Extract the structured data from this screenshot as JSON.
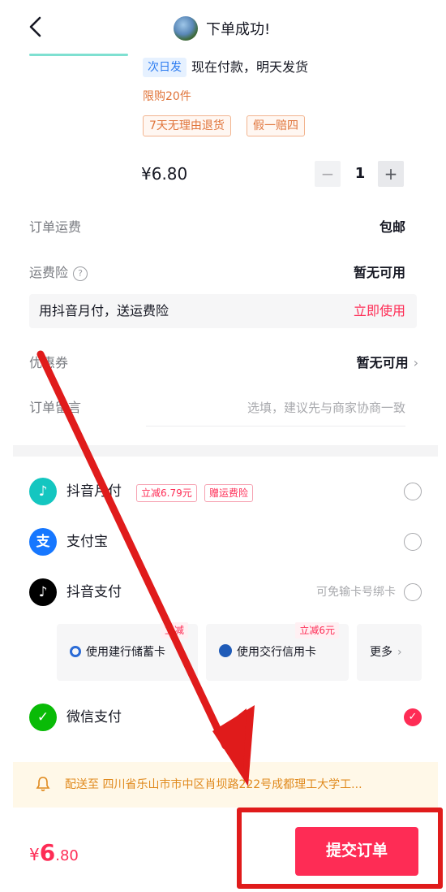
{
  "header": {
    "title": "下单成功!",
    "back_icon": "chevron-left-icon"
  },
  "product": {
    "ship_tag": "次日发",
    "ship_text": "现在付款，明天发货",
    "limit": "限购20件",
    "service_tags": [
      "7天无理由退货",
      "假一赔四"
    ],
    "price": "¥6.80",
    "quantity": "1",
    "minus": "−",
    "plus": "+"
  },
  "order": {
    "shipping_label": "订单运费",
    "shipping_value": "包邮",
    "insurance_label": "运费险",
    "insurance_value": "暂无可用",
    "promo_text": "用抖音月付，送运费险",
    "promo_link": "立即使用",
    "coupon_label": "优惠券",
    "coupon_value": "暂无可用",
    "remark_label": "订单留言",
    "remark_placeholder": "选填，建议先与商家协商一致"
  },
  "payment": {
    "methods": [
      {
        "label": "抖音月付",
        "badges": [
          "立减6.79元",
          "赠运费险"
        ],
        "selected": false
      },
      {
        "label": "支付宝",
        "selected": false
      },
      {
        "label": "抖音支付",
        "hint": "可免输卡号绑卡",
        "selected": false
      },
      {
        "label": "微信支付",
        "selected": true
      }
    ],
    "cards": [
      {
        "label": "使用建行储蓄卡",
        "badge": "立减"
      },
      {
        "label": "使用交行信用卡",
        "badge": "立减6元"
      },
      {
        "label": "更多"
      }
    ]
  },
  "address": {
    "text": "配送至 四川省乐山市市中区肖坝路222号成都理工大学工..."
  },
  "footer": {
    "total_symbol": "¥",
    "total_int": "6",
    "total_dec": ".80",
    "submit_label": "提交订单"
  },
  "colors": {
    "accent": "#fe2c55",
    "annotation": "#e01b1b",
    "warning": "#e08a1e",
    "link_blue": "#2b7bf0"
  }
}
